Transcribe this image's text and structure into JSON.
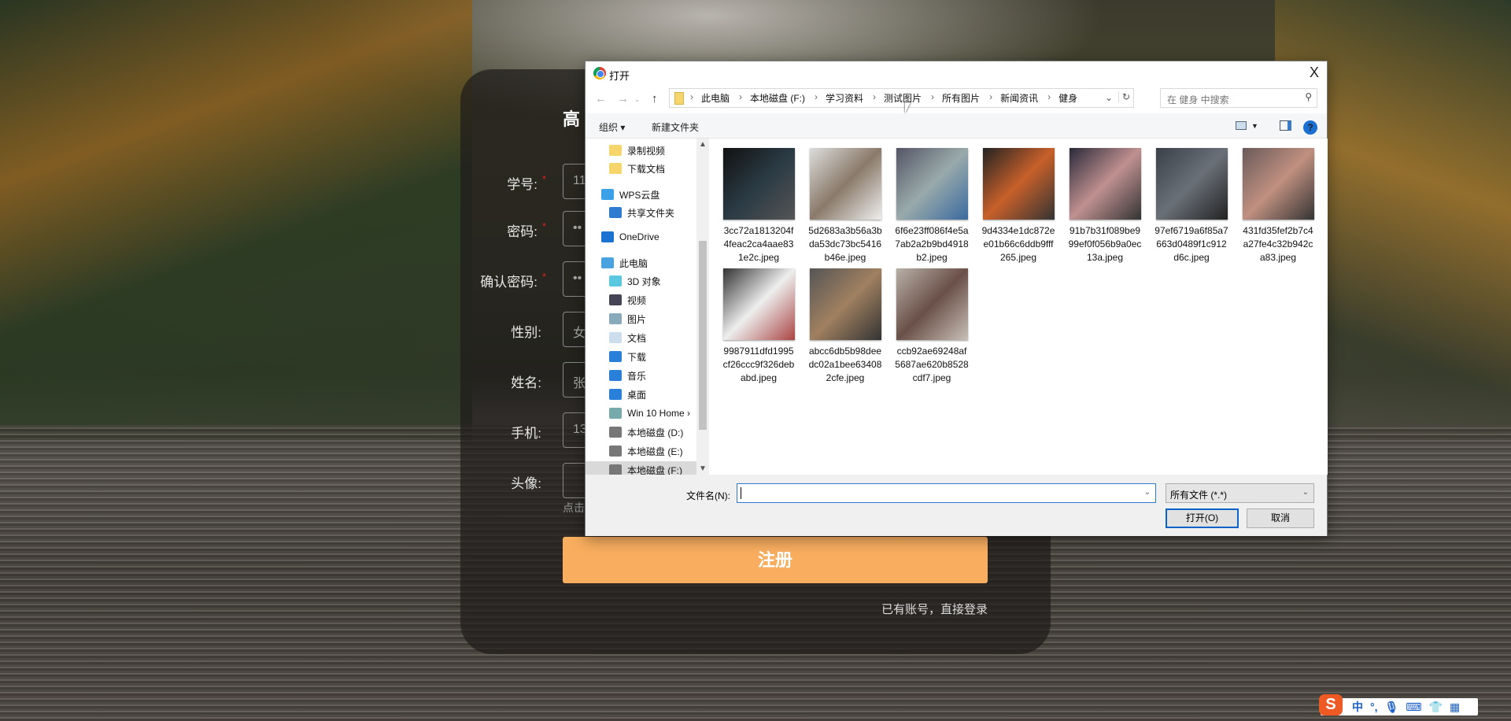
{
  "form": {
    "title": "高",
    "fields": [
      {
        "label": "学号:",
        "required": true,
        "value": "11"
      },
      {
        "label": "密码:",
        "required": true,
        "value": "••"
      },
      {
        "label": "确认密码:",
        "required": true,
        "value": "••"
      },
      {
        "label": "性别:",
        "required": false,
        "value": "女"
      },
      {
        "label": "姓名:",
        "required": false,
        "value": "张"
      },
      {
        "label": "手机:",
        "required": false,
        "value": "13"
      },
      {
        "label": "头像:",
        "required": false,
        "value": ""
      }
    ],
    "required_mark": "*",
    "hint": "点击",
    "register": "注册",
    "login_link": "已有账号，直接登录"
  },
  "dialog": {
    "title": "打开",
    "close": "X",
    "breadcrumb": [
      "此电脑",
      "本地磁盘 (F:)",
      "学习资料",
      "测试图片",
      "所有图片",
      "新闻资讯",
      "健身"
    ],
    "search_placeholder": "在 健身 中搜索",
    "toolbar": {
      "organize": "组织 ▾",
      "new_folder": "新建文件夹"
    },
    "nav": [
      {
        "label": "录制视频",
        "icon": "folder-icon"
      },
      {
        "label": "下载文档",
        "icon": "folder-icon"
      },
      {
        "label": "WPS云盘",
        "icon": "cloud-icon"
      },
      {
        "label": "共享文件夹",
        "icon": "share-icon"
      },
      {
        "label": "OneDrive",
        "icon": "onedrive-icon"
      },
      {
        "label": "此电脑",
        "icon": "computer-icon"
      },
      {
        "label": "3D 对象",
        "icon": "cube-icon"
      },
      {
        "label": "视频",
        "icon": "video-icon"
      },
      {
        "label": "图片",
        "icon": "picture-icon"
      },
      {
        "label": "文档",
        "icon": "document-icon"
      },
      {
        "label": "下载",
        "icon": "download-icon"
      },
      {
        "label": "音乐",
        "icon": "music-icon"
      },
      {
        "label": "桌面",
        "icon": "desktop-icon"
      },
      {
        "label": "Win 10 Home ›",
        "icon": "network-drive-icon"
      },
      {
        "label": "本地磁盘 (D:)",
        "icon": "drive-icon"
      },
      {
        "label": "本地磁盘 (E:)",
        "icon": "drive-icon"
      },
      {
        "label": "本地磁盘 (F:)",
        "icon": "drive-icon",
        "selected": true
      }
    ],
    "files": [
      "3cc72a1813204f4feac2ca4aae831e2c.jpeg",
      "5d2683a3b56a3bda53dc73bc5416b46e.jpeg",
      "6f6e23ff086f4e5a7ab2a2b9bd4918b2.jpeg",
      "9d4334e1dc872ee01b66c6ddb9fff265.jpeg",
      "91b7b31f089be999ef0f056b9a0ec13a.jpeg",
      "97ef6719a6f85a7663d0489f1c912d6c.jpeg",
      "431fd35fef2b7c4a27fe4c32b942ca83.jpeg",
      "9987911dfd1995cf26ccc9f326debabd.jpeg",
      "abcc6db5b98deedc02a1bee634082cfe.jpeg",
      "ccb92ae69248af5687ae620b8528cdf7.jpeg"
    ],
    "filename_label": "文件名(N):",
    "filename_value": "",
    "filter": "所有文件 (*.*)",
    "open": "打开(O)",
    "cancel": "取消"
  },
  "ime": {
    "logo": "S",
    "mode": "中",
    "punct": "°,"
  }
}
